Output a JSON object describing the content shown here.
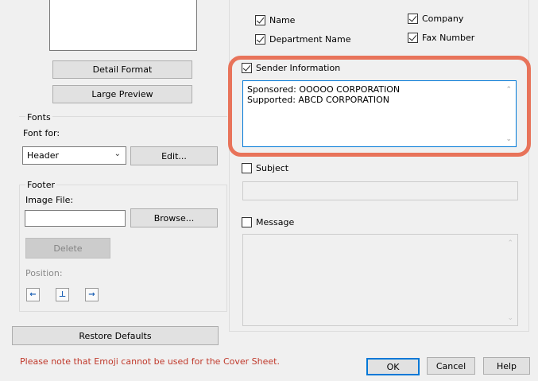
{
  "preview": {
    "detail_format": "Detail Format",
    "large_preview": "Large Preview"
  },
  "fonts": {
    "group_label": "Fonts",
    "font_for_label": "Font for:",
    "selected": "Header",
    "edit_button": "Edit..."
  },
  "footer": {
    "group_label": "Footer",
    "image_file_label": "Image File:",
    "image_file_value": "",
    "browse_button": "Browse...",
    "delete_button": "Delete",
    "position_label": "Position:"
  },
  "restore_defaults": "Restore Defaults",
  "header_options": {
    "name": "Name",
    "company": "Company",
    "department_name": "Department Name",
    "fax_number": "Fax Number"
  },
  "sender_information": {
    "label": "Sender Information",
    "checked": true,
    "line1": "Sponsored: OOOOO CORPORATION",
    "line2": "Supported: ABCD CORPORATION"
  },
  "subject": {
    "label": "Subject",
    "checked": false,
    "value": ""
  },
  "message": {
    "label": "Message",
    "checked": false,
    "value": ""
  },
  "notice": "Please note that Emoji cannot be used for the Cover Sheet.",
  "dialog_buttons": {
    "ok": "OK",
    "cancel": "Cancel",
    "help": "Help"
  },
  "colors": {
    "notice_text": "#c0392b",
    "highlight_ring": "#e8735a",
    "focus_blue": "#0078d7"
  }
}
